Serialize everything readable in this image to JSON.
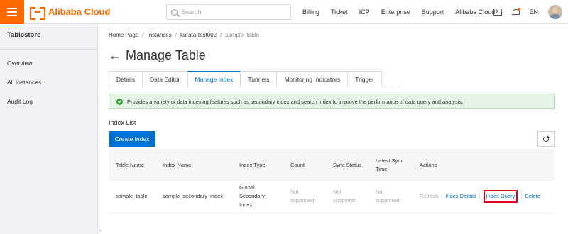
{
  "topbar": {
    "brand": "Alibaba Cloud",
    "search_placeholder": "Search",
    "nav": [
      "Billing",
      "Ticket",
      "ICP",
      "Enterprise",
      "Support",
      "Alibaba Cloud"
    ],
    "lang": "EN"
  },
  "sidebar": {
    "title": "Tablestore",
    "items": [
      "Overview",
      "All Instances",
      "Audit Log"
    ]
  },
  "breadcrumb": [
    "Home Page",
    "Instances",
    "kurata-test002",
    "sample_table"
  ],
  "page": {
    "title": "Manage Table"
  },
  "tabs": [
    "Details",
    "Data Editor",
    "Manage Index",
    "Tunnels",
    "Monitoring Indicators",
    "Trigger"
  ],
  "active_tab": "Manage Index",
  "notice": "Provides a variety of data indexing features such as secondary index and search index to improve the performance of data query and analysis.",
  "index_list": {
    "label": "Index List",
    "create_button": "Create Index",
    "headers": [
      "Table Name",
      "Index Name",
      "Index Type",
      "Count",
      "Sync Status",
      "Latest Sync Time",
      "Actions"
    ],
    "rows": [
      {
        "table_name": "sample_table",
        "index_name": "sample_secondary_index",
        "index_type": "Global Secondary Index",
        "count": "Not supported",
        "sync_status": "Not supported",
        "latest_sync_time": "Not supported",
        "actions": [
          "Refresh",
          "Index Details",
          "Index Query",
          "Delete"
        ]
      }
    ]
  },
  "colors": {
    "brand": "#ff6a00",
    "primary": "#0070cc",
    "highlight": "#e1001b",
    "notice_bg": "#e5f4e4"
  }
}
